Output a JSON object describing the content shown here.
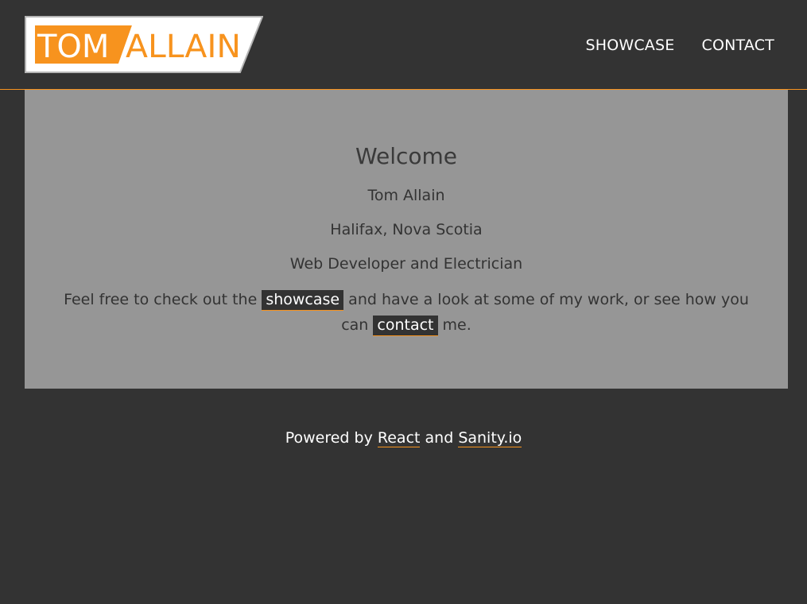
{
  "header": {
    "logo": {
      "part1": "TOM",
      "part2": "ALLAIN",
      "accent_color": "#f7931e",
      "frame_color": "#b5b5b5"
    },
    "nav": [
      {
        "label": "SHOWCASE"
      },
      {
        "label": "CONTACT"
      }
    ]
  },
  "welcome": {
    "title": "Welcome",
    "name": "Tom Allain",
    "location": "Halifax, Nova Scotia",
    "role": "Web Developer and Electrician",
    "invite": {
      "text1": "Feel free to check out the",
      "link1": "showcase",
      "text2": "and have a look at some of my work, or see how you can",
      "link2": "contact",
      "text3": "me."
    }
  },
  "footer": {
    "text1": "Powered by",
    "link1": "React",
    "text2": "and",
    "link2": "Sanity.io"
  },
  "colors": {
    "background": "#333333",
    "panel": "#969696",
    "accent": "#f7931e"
  }
}
